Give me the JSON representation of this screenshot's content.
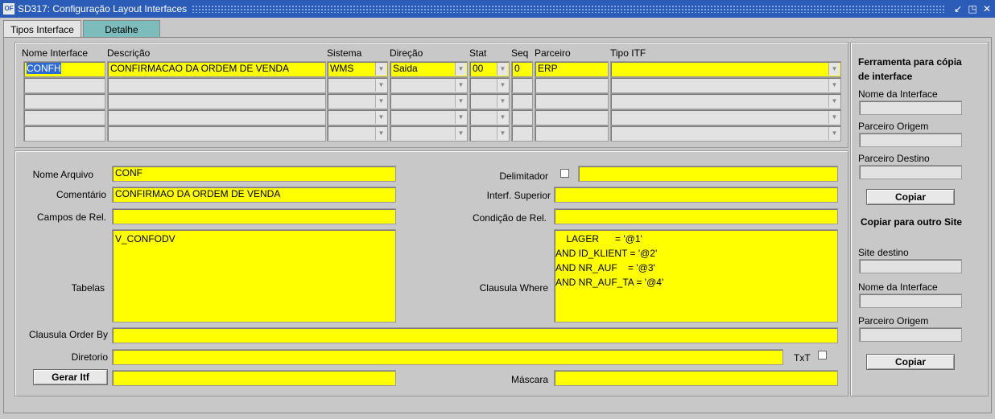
{
  "window": {
    "title": "SD317: Configuração Layout Interfaces",
    "icon": "oracle-forms-icon"
  },
  "tabs": [
    {
      "label": "Tipos Interface"
    },
    {
      "label": "Detalhe"
    }
  ],
  "grid": {
    "headers": {
      "nome": "Nome Interface",
      "descricao": "Descrição",
      "sistema": "Sistema",
      "direcao": "Direção",
      "stat": "Stat",
      "seq": "Seq",
      "parceiro": "Parceiro",
      "tipo_itf": "Tipo ITF"
    },
    "rows": [
      {
        "nome": "CONFH",
        "descricao": "CONFIRMACAO DA ORDEM DE VENDA",
        "sistema": "WMS",
        "direcao": "Saida",
        "stat": "00",
        "seq": "0",
        "parceiro": "ERP",
        "tipo_itf": ""
      }
    ]
  },
  "detail": {
    "nome_arquivo": {
      "label": "Nome Arquivo",
      "value": "CONF"
    },
    "comentario": {
      "label": "Comentário",
      "value": "CONFIRMAO DA ORDEM DE VENDA"
    },
    "campos_rel": {
      "label": "Campos de Rel.",
      "value": ""
    },
    "tabelas": {
      "label": "Tabelas",
      "value": "V_CONFODV"
    },
    "order_by": {
      "label": "Clausula Order By",
      "value": ""
    },
    "diretorio": {
      "label": "Diretorio",
      "value": ""
    },
    "txt": {
      "label": "TxT",
      "checked": false
    },
    "gerar_itf": {
      "label": "Gerar Itf",
      "value": ""
    },
    "delimitador": {
      "label": "Delimitador",
      "checked": false,
      "value": ""
    },
    "interf_superior": {
      "label": "Interf. Superior",
      "value": ""
    },
    "condicao_rel": {
      "label": "Condição de Rel.",
      "value": ""
    },
    "clausula_where": {
      "label": "Clausula Where",
      "value": "    LAGER      = '@1'\nAND ID_KLIENT = '@2'\nAND NR_AUF    = '@3'\nAND NR_AUF_TA = '@4'"
    },
    "mascara": {
      "label": "Máscara",
      "value": ""
    }
  },
  "sidebar": {
    "copy_tool": {
      "title": "Ferramenta para cópia de interface",
      "nome_interface": {
        "label": "Nome da Interface",
        "value": ""
      },
      "parceiro_origem": {
        "label": "Parceiro Origem",
        "value": ""
      },
      "parceiro_destino": {
        "label": "Parceiro Destino",
        "value": ""
      },
      "button": "Copiar"
    },
    "copy_site": {
      "title": "Copiar para outro Site",
      "site_destino": {
        "label": "Site destino",
        "value": ""
      },
      "nome_interface": {
        "label": "Nome da Interface",
        "value": ""
      },
      "parceiro_origem": {
        "label": "Parceiro Origem",
        "value": ""
      },
      "button": "Copiar"
    }
  },
  "colors": {
    "required_field": "#ffff00",
    "titlebar": "#2a5cb8",
    "tab_inactive": "#7cbcbc"
  }
}
